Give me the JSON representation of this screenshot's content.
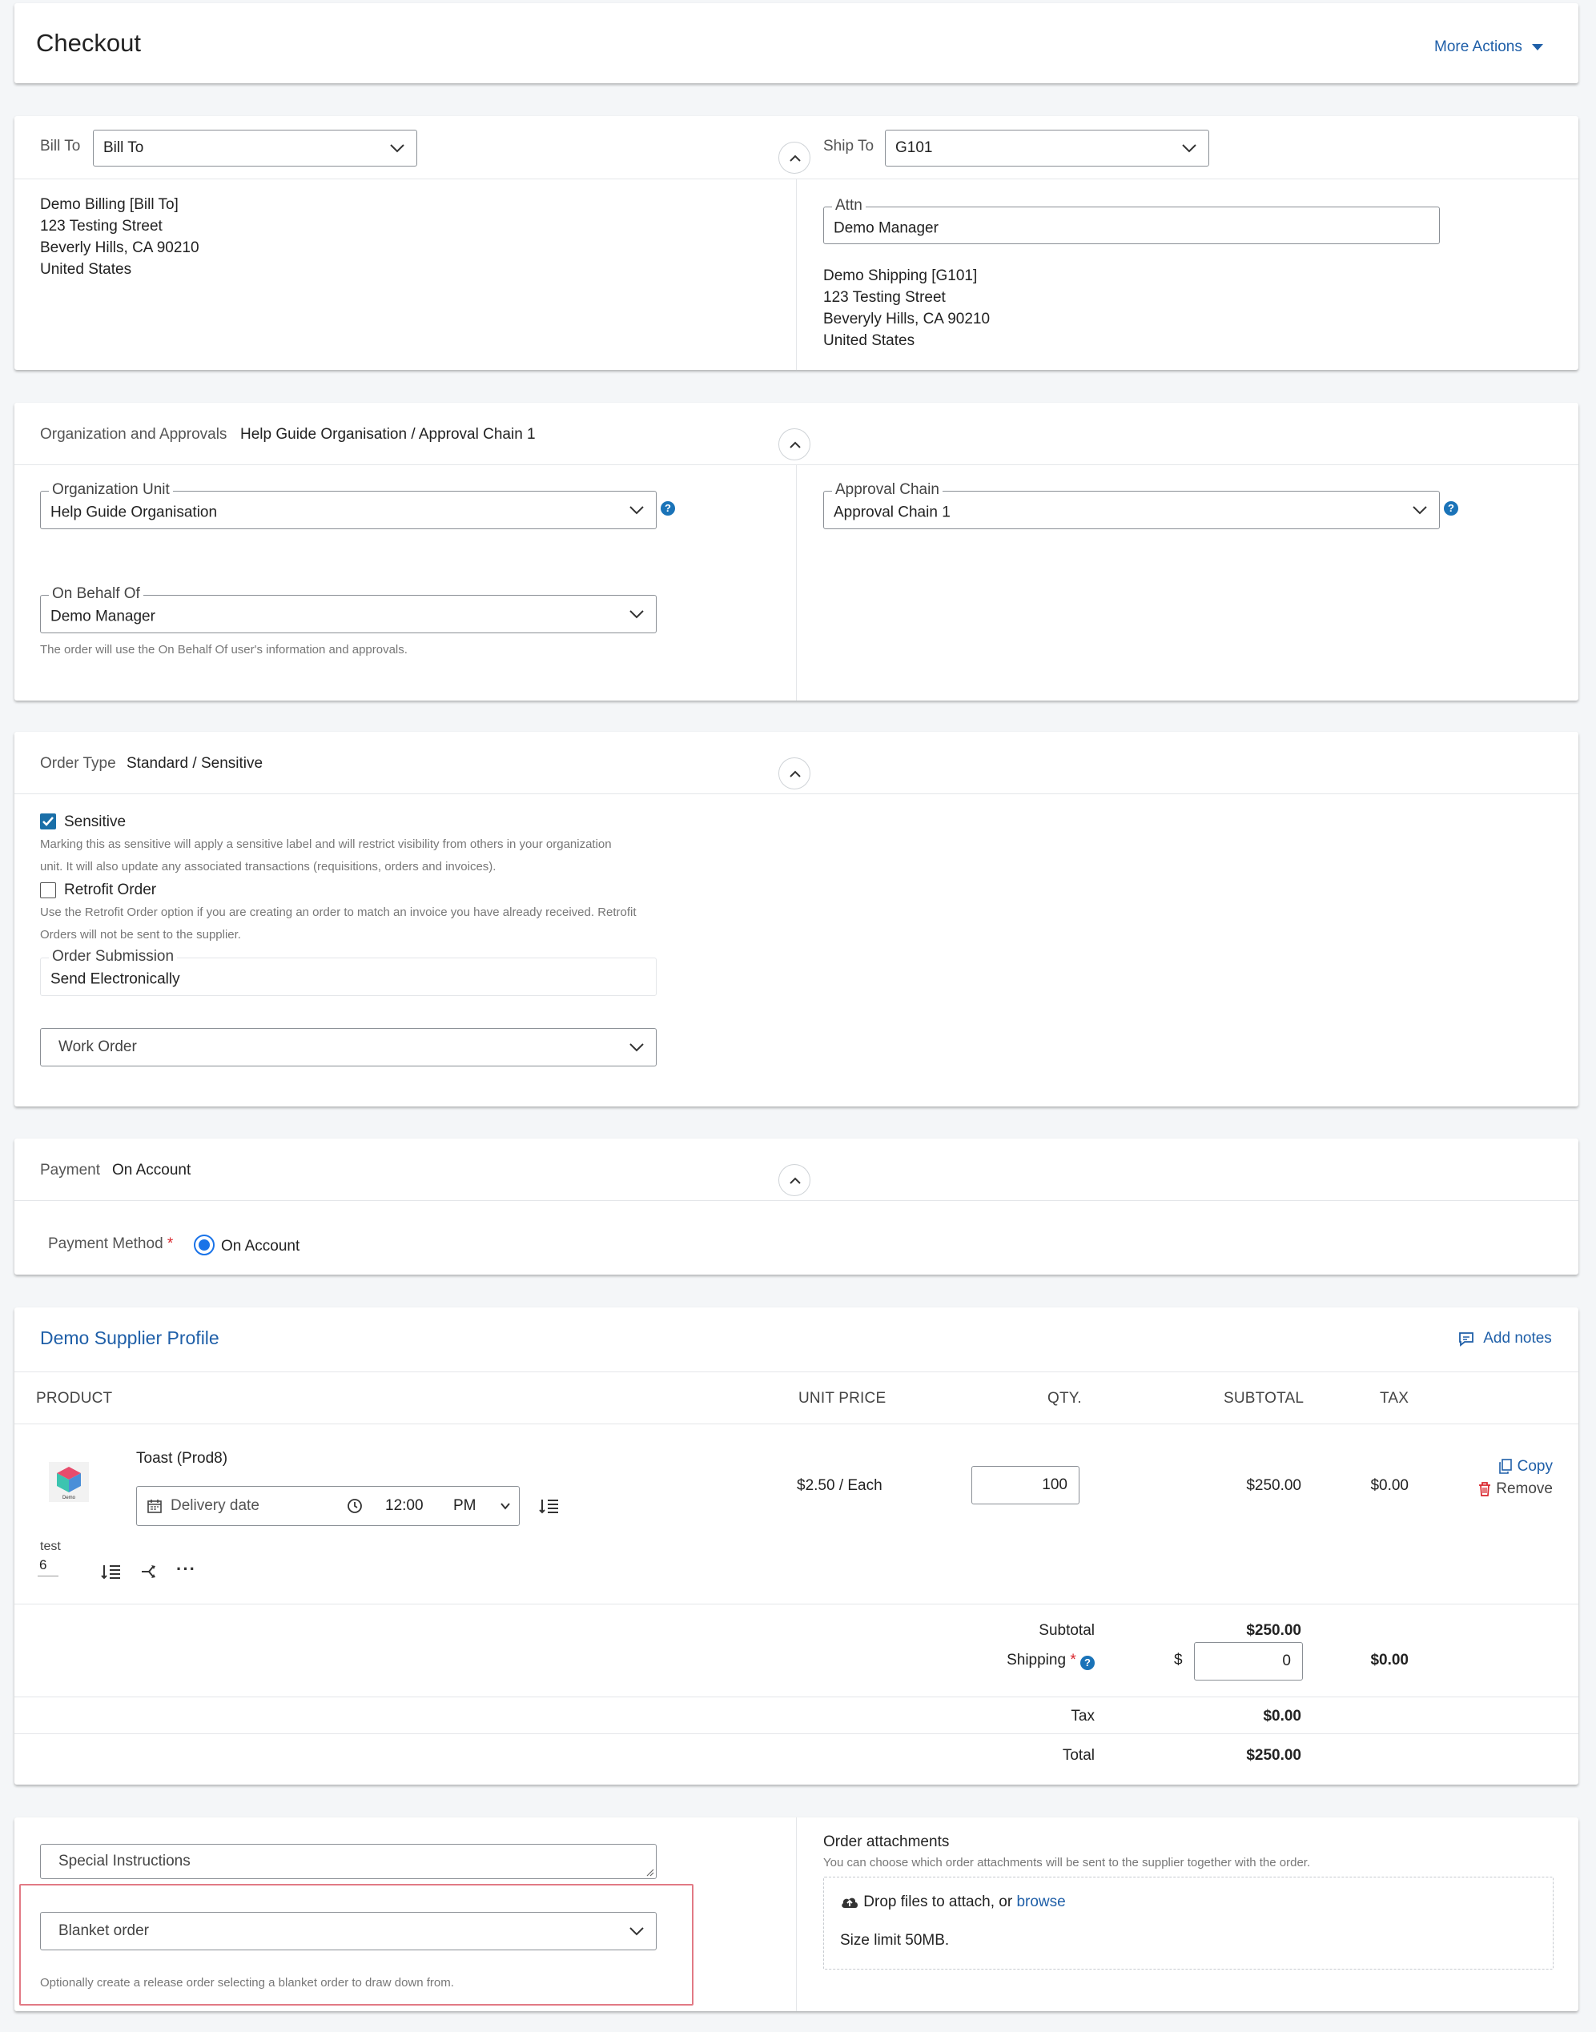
{
  "header": {
    "title": "Checkout",
    "more_actions": "More Actions"
  },
  "addresses": {
    "bill_to_label": "Bill To",
    "bill_to_value": "Bill To",
    "bill_lines": [
      "Demo Billing [Bill To]",
      "123 Testing Street",
      "Beverly Hills, CA 90210",
      "United States"
    ],
    "ship_to_label": "Ship To",
    "ship_to_value": "G101",
    "attn_label": "Attn",
    "attn_value": "Demo Manager",
    "ship_lines": [
      "Demo Shipping [G101]",
      "123 Testing Street",
      "Beveryly Hills, CA 90210",
      "United States"
    ]
  },
  "org": {
    "section_label": "Organization and Approvals",
    "section_value": "Help Guide Organisation / Approval Chain 1",
    "unit_label": "Organization Unit",
    "unit_value": "Help Guide Organisation",
    "chain_label": "Approval Chain",
    "chain_value": "Approval Chain 1",
    "behalf_label": "On Behalf Of",
    "behalf_value": "Demo Manager",
    "behalf_help": "The order will use the On Behalf Of user's information and approvals."
  },
  "order_type": {
    "section_label": "Order Type",
    "section_value": "Standard / Sensitive",
    "sensitive_label": "Sensitive",
    "sensitive_checked": true,
    "sensitive_help_1": "Marking this as sensitive will apply a sensitive label and will restrict visibility from others in your organization",
    "sensitive_help_2": "unit. It will also update any associated transactions (requisitions, orders and invoices).",
    "retrofit_label": "Retrofit Order",
    "retrofit_checked": false,
    "retrofit_help_1": "Use the Retrofit Order option if you are creating an order to match an invoice you have already received. Retrofit",
    "retrofit_help_2": "Orders will not be sent to the supplier.",
    "submission_label": "Order Submission",
    "submission_value": "Send Electronically",
    "work_order_placeholder": "Work Order"
  },
  "payment": {
    "section_label": "Payment",
    "section_value": "On Account",
    "method_label": "Payment Method",
    "required_mark": "*",
    "method_option": "On Account"
  },
  "supplier": {
    "name": "Demo Supplier Profile",
    "add_notes": "Add notes",
    "columns": {
      "product": "PRODUCT",
      "unit_price": "UNIT PRICE",
      "qty": "QTY.",
      "subtotal": "SUBTOTAL",
      "tax": "TAX"
    },
    "item": {
      "name": "Toast (Prod8)",
      "logo_text": "Demo",
      "delivery_placeholder": "Delivery date",
      "time_value": "12:00",
      "ampm": "PM",
      "unit_price": "$2.50 / Each",
      "qty": "100",
      "subtotal": "$250.00",
      "tax": "$0.00",
      "copy": "Copy",
      "remove": "Remove",
      "custom_field_label": "test",
      "custom_field_value": "6",
      "more_glyph": "···"
    },
    "totals": {
      "subtotal_label": "Subtotal",
      "subtotal_value": "$250.00",
      "shipping_label": "Shipping",
      "required_mark": "*",
      "currency_symbol": "$",
      "shipping_input": "0",
      "shipping_tax": "$0.00",
      "tax_label": "Tax",
      "tax_value": "$0.00",
      "total_label": "Total",
      "total_value": "$250.00"
    }
  },
  "footer": {
    "special_instructions_placeholder": "Special Instructions",
    "blanket_order_placeholder": "Blanket order",
    "blanket_help": "Optionally create a release order selecting a blanket order to draw down from.",
    "attachments_title": "Order attachments",
    "attachments_help": "You can choose which order attachments will be sent to the supplier together with the order.",
    "drop_text": "Drop files to attach, or",
    "browse": "browse",
    "size_limit": "Size limit 50MB."
  },
  "colors": {
    "accent": "#1f5fa8",
    "checkbox": "#1a6fa8",
    "remove": "#d9262d",
    "highlight": "#e27a85"
  }
}
